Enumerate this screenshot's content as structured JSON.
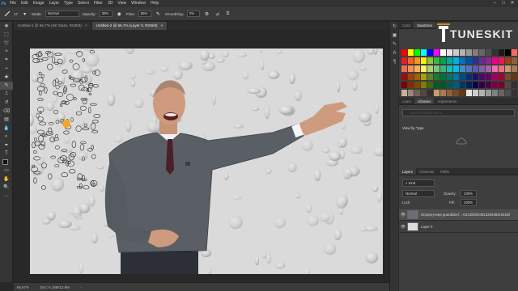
{
  "menu": {
    "logo": "Ps",
    "items": [
      "File",
      "Edit",
      "Image",
      "Layer",
      "Type",
      "Select",
      "Filter",
      "3D",
      "View",
      "Window",
      "Help"
    ],
    "minimize": "–",
    "maximize": "□",
    "close": "✕"
  },
  "options": {
    "mode_label": "Mode:",
    "mode_value": "Normal",
    "opacity_label": "Opacity:",
    "opacity_value": "38%",
    "flow_label": "Flow:",
    "flow_value": "55%",
    "smoothing_label": "Smoothing:",
    "smoothing_value": "0%",
    "brush_size": "17"
  },
  "tabs": [
    {
      "label": "Untitled-1 @ 66.7% (Mr Glass, RGB/8)",
      "close": "×"
    },
    {
      "label": "Untitled-2 @ 66.7% (Layer 0, RGB/8)",
      "close": "×"
    }
  ],
  "status": {
    "zoom": "66.67%",
    "doc": "Doc: 6.18M/12.9M"
  },
  "swatches_panel": {
    "tabs": [
      "Color",
      "Swatches"
    ],
    "colors": [
      [
        "#ff0000",
        "#ffff00",
        "#00ff00",
        "#00ffff",
        "#0000ff",
        "#ff00ff",
        "#ffffff",
        "#e6e6e6",
        "#cccccc",
        "#b3b3b3",
        "#999999",
        "#808080",
        "#666666",
        "#4d4d4d",
        "#333333",
        "#1a1a1a",
        "#000000",
        "#ff6666"
      ],
      [
        "#ed1c24",
        "#f26522",
        "#f7941d",
        "#fff200",
        "#8dc63f",
        "#39b54a",
        "#00a651",
        "#00a99d",
        "#00aeef",
        "#0072bc",
        "#0054a6",
        "#2e3192",
        "#662d91",
        "#92278f",
        "#ec008c",
        "#ed145b",
        "#a0410d",
        "#8c6239"
      ],
      [
        "#f26c4f",
        "#f68e56",
        "#fbaf5d",
        "#fff568",
        "#acd373",
        "#7cc576",
        "#3bb878",
        "#1abbb4",
        "#00bff3",
        "#438ccb",
        "#5574b9",
        "#605ca8",
        "#855fa8",
        "#a763a8",
        "#f06eaa",
        "#f26d7d",
        "#c69c6d",
        "#a67c52"
      ],
      [
        "#9e0b0f",
        "#a0410d",
        "#a3620a",
        "#aba000",
        "#598527",
        "#197b30",
        "#007236",
        "#00746b",
        "#0076a3",
        "#004b80",
        "#003471",
        "#1b1464",
        "#440e62",
        "#630460",
        "#9e005d",
        "#9e0039",
        "#754c24",
        "#603913"
      ],
      [
        "#790000",
        "#7b2e00",
        "#7d4900",
        "#827b00",
        "#406618",
        "#005e20",
        "#005826",
        "#005952",
        "#005b7f",
        "#003663",
        "#002157",
        "#0d004c",
        "#32004b",
        "#4b0049",
        "#7b0046",
        "#7a0026",
        "#534741",
        "#362f2d"
      ],
      [
        "#c7b299",
        "#998675",
        "#736357",
        "#534741",
        "#37302d",
        "#c69c6d",
        "#a67c52",
        "#8c6239",
        "#754c24",
        "#603913",
        "#e6e6e6",
        "#cccccc",
        "#b3b3b3",
        "#999999",
        "#808080",
        "#666666",
        "#4d4d4d",
        "#333333"
      ]
    ]
  },
  "brand": {
    "logo_text": "TUNESKIT"
  },
  "learn_panel": {
    "tabs": [
      "Learn",
      "Libraries",
      "Adjustments"
    ],
    "search_placeholder": "Search Adobe Stock",
    "view_by": "View by Type",
    "size_text": "-- KB"
  },
  "layers_panel": {
    "tabs": [
      "Layers",
      "Channels",
      "Paths"
    ],
    "kind": "Kind",
    "blend_mode": "Normal",
    "opacity_label": "Opacity:",
    "opacity_value": "100%",
    "lock_label": "Lock:",
    "fill_label": "Fill:",
    "fill_value": "100%",
    "layers": [
      {
        "name": "0zzpep-josep-guardiola-f...-03.0283044913284384161635",
        "visible": "👁"
      },
      {
        "name": "Layer 0",
        "visible": "👁"
      }
    ]
  }
}
